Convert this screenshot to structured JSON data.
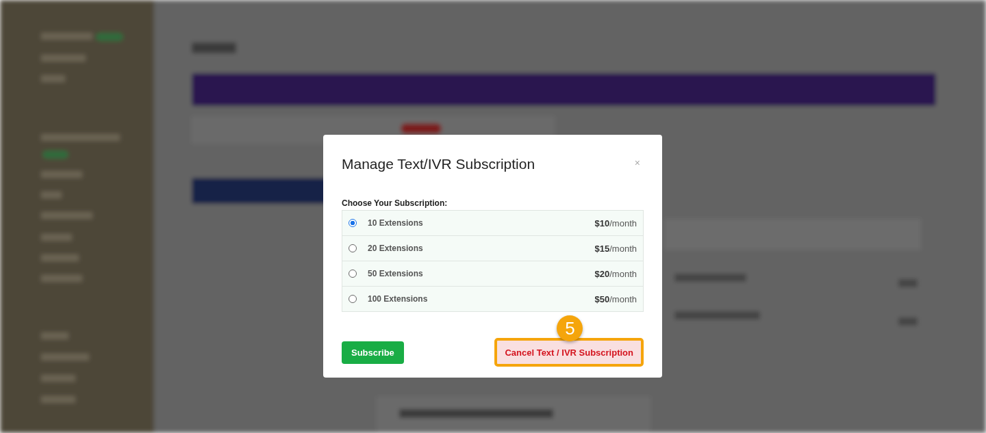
{
  "modal": {
    "title": "Manage Text/IVR Subscription",
    "close": "×",
    "subscription_label": "Choose Your Subscription:",
    "options": [
      {
        "label": "10 Extensions",
        "price": "**$10**/month",
        "selected": true
      },
      {
        "label": "20 Extensions",
        "price": "**$15**/month",
        "selected": false
      },
      {
        "label": "50 Extensions",
        "price": "**$20**/month",
        "selected": false
      },
      {
        "label": "100 Extensions",
        "price": "**$50**/month",
        "selected": false
      }
    ],
    "subscribe_button": "Subscribe",
    "cancel_button": "Cancel Text / IVR Subscription"
  },
  "callout": {
    "step": "5"
  }
}
